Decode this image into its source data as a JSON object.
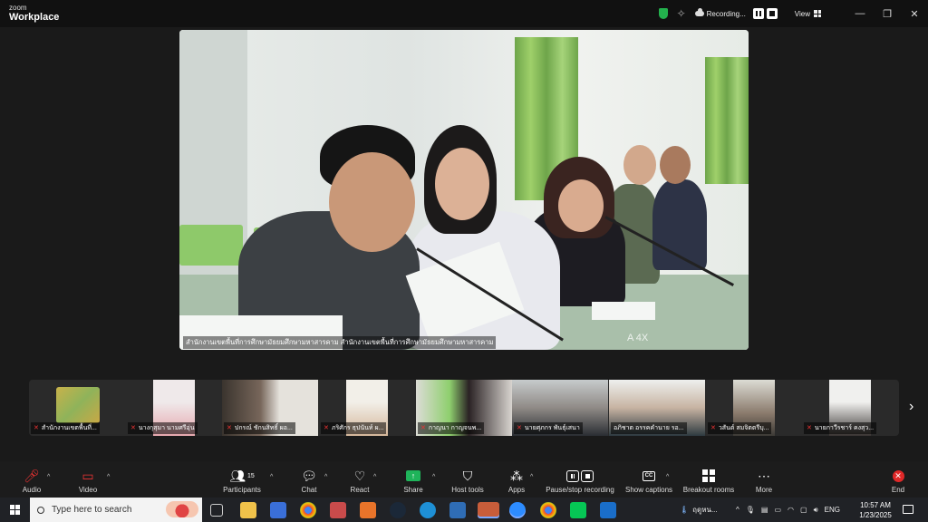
{
  "titlebar": {
    "brand_top": "zoom",
    "brand_bottom": "Workplace",
    "recording_label": "Recording...",
    "view_label": "View",
    "window_controls": [
      "—",
      "❐",
      "✕"
    ]
  },
  "main_video": {
    "caption": "สำนักงานเขตพื้นที่การศึกษามัธยมศึกษามหาสารคาม สำนักงานเขตพื้นที่การศึกษามัธยมศึกษามหาสารคาม",
    "watermark": "A  4X"
  },
  "participants_strip": [
    {
      "name": "สำนักงานเขตพื้นที่...",
      "muted": true
    },
    {
      "name": "นางกุสุมา นามศรีอุ่น",
      "muted": true
    },
    {
      "name": "ปกรณ์ ชักนสิทธิ์ ผอ...",
      "muted": true
    },
    {
      "name": "ภริศักร ธุปนันท์ ผ...",
      "muted": true
    },
    {
      "name": "กาญนา กาญจนพ...",
      "muted": true
    },
    {
      "name": "นายศุภกร พันธุ์เสนา",
      "muted": true
    },
    {
      "name": "อภิชาต อรรคคำนาย รอ...",
      "muted": false
    },
    {
      "name": "วสันต์ สมจิตตรีบุ...",
      "muted": true
    },
    {
      "name": "นายกาวีรชาร์ คงสุว...",
      "muted": true
    }
  ],
  "toolbar": {
    "audio": "Audio",
    "video": "Video",
    "participants": "Participants",
    "participants_count": "15",
    "chat": "Chat",
    "react": "React",
    "share": "Share",
    "host_tools": "Host tools",
    "apps": "Apps",
    "pause_stop": "Pause/stop recording",
    "captions": "Show captions",
    "captions_icon_text": "CC",
    "breakout": "Breakout rooms",
    "more": "More",
    "end": "End"
  },
  "taskbar": {
    "search_placeholder": "Type here to search",
    "weather": "ฤดูหน...",
    "language": "ENG",
    "time": "10:57 AM",
    "date": "1/23/2025"
  },
  "colors": {
    "recording_shield": "#23b14d",
    "share_green": "#1fb45a",
    "end_red": "#e02828"
  }
}
